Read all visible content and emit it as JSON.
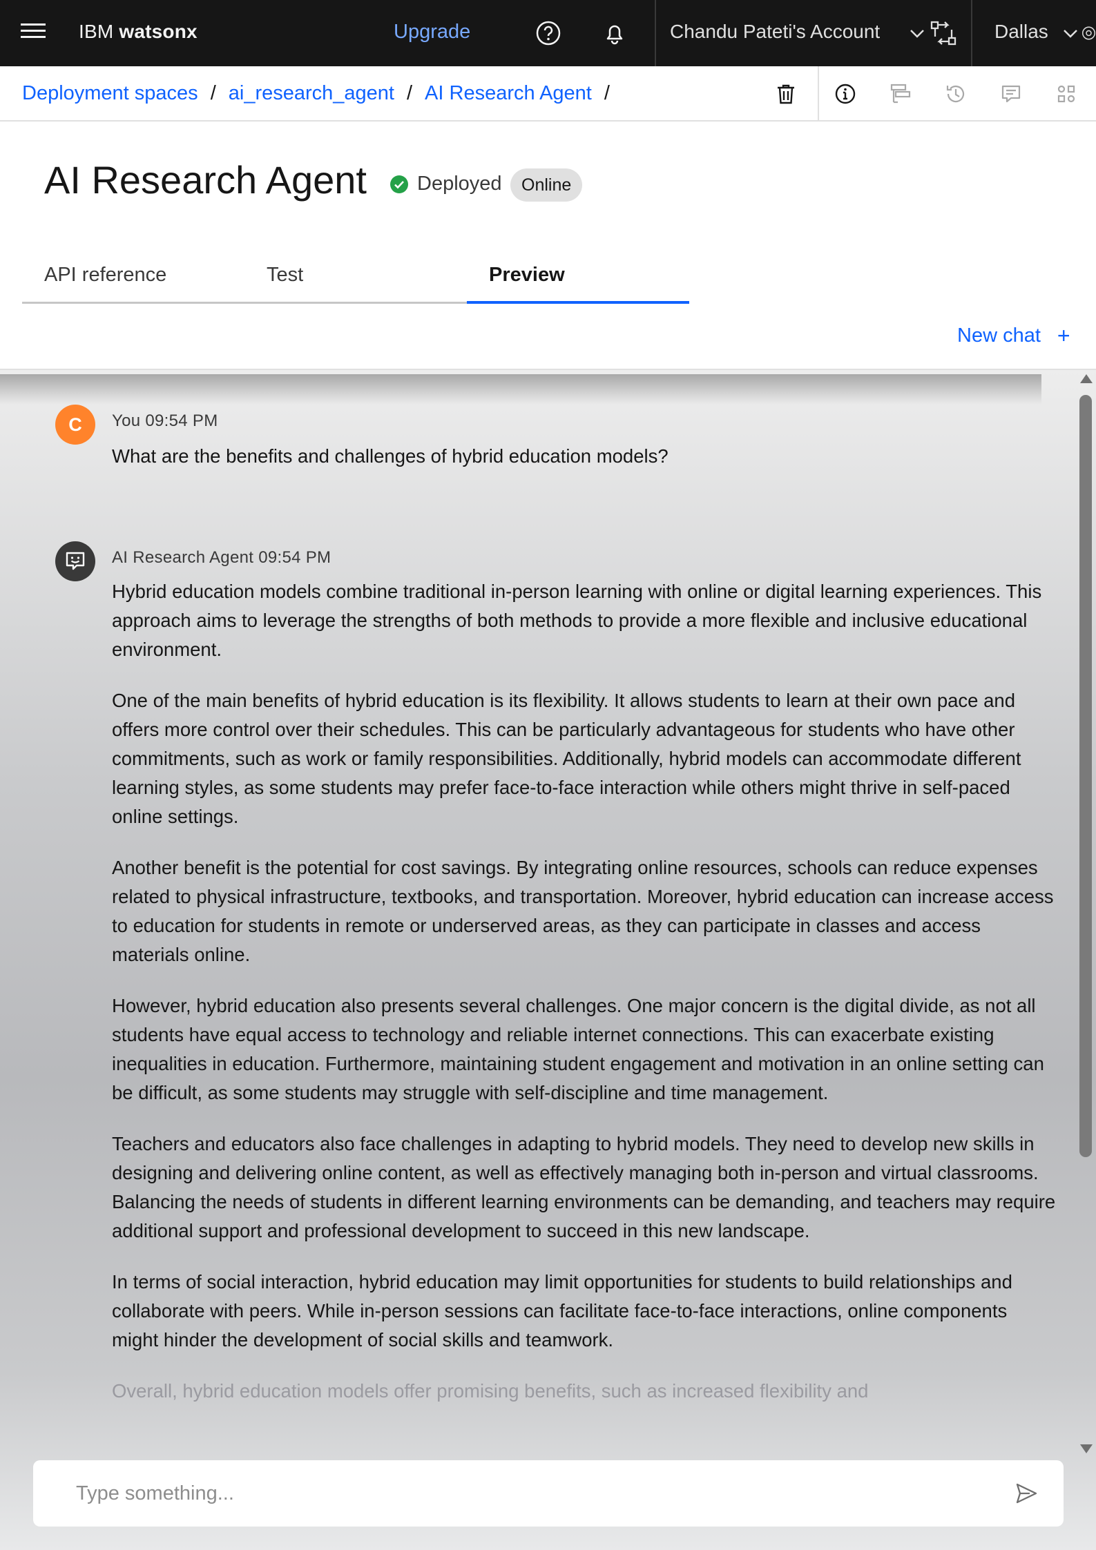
{
  "topbar": {
    "brand_prefix": "IBM ",
    "brand_name": "watsonx",
    "upgrade": "Upgrade",
    "account": "Chandu Pateti's Account",
    "region": "Dallas"
  },
  "breadcrumb": {
    "items": [
      "Deployment spaces",
      "ai_research_agent",
      "AI Research Agent"
    ],
    "separator": "/"
  },
  "page": {
    "title": "AI Research Agent",
    "status": "Deployed",
    "tag": "Online"
  },
  "tabs": [
    {
      "label": "API reference",
      "active": false
    },
    {
      "label": "Test",
      "active": false
    },
    {
      "label": "Preview",
      "active": true
    }
  ],
  "new_chat": "New chat",
  "chat": {
    "user": {
      "avatar_initial": "C",
      "meta": "You 09:54 PM",
      "text": "What are the benefits and challenges of hybrid education models?"
    },
    "agent": {
      "meta": "AI Research Agent 09:54 PM",
      "paragraphs": [
        "Hybrid education models combine traditional in-person learning with online or digital learning experiences. This approach aims to leverage the strengths of both methods to provide a more flexible and inclusive educational environment.",
        "One of the main benefits of hybrid education is its flexibility. It allows students to learn at their own pace and offers more control over their schedules. This can be particularly advantageous for students who have other commitments, such as work or family responsibilities. Additionally, hybrid models can accommodate different learning styles, as some students may prefer face-to-face interaction while others might thrive in self-paced online settings.",
        "Another benefit is the potential for cost savings. By integrating online resources, schools can reduce expenses related to physical infrastructure, textbooks, and transportation. Moreover, hybrid education can increase access to education for students in remote or underserved areas, as they can participate in classes and access materials online.",
        "However, hybrid education also presents several challenges. One major concern is the digital divide, as not all students have equal access to technology and reliable internet connections. This can exacerbate existing inequalities in education. Furthermore, maintaining student engagement and motivation in an online setting can be difficult, as some students may struggle with self-discipline and time management.",
        "Teachers and educators also face challenges in adapting to hybrid models. They need to develop new skills in designing and delivering online content, as well as effectively managing both in-person and virtual classrooms. Balancing the needs of students in different learning environments can be demanding, and teachers may require additional support and professional development to succeed in this new landscape.",
        "In terms of social interaction, hybrid education may limit opportunities for students to build relationships and collaborate with peers. While in-person sessions can facilitate face-to-face interactions, online components might hinder the development of social skills and teamwork.",
        "Overall, hybrid education models offer promising benefits, such as increased flexibility and"
      ]
    }
  },
  "composer": {
    "placeholder": "Type something..."
  },
  "colors": {
    "accent": "#0f62fe",
    "topbar_bg": "#161616",
    "user_avatar": "#ff832b",
    "deployed_green": "#24a148"
  },
  "icons": [
    "menu-icon",
    "help-icon",
    "notification-icon",
    "switcher-icon",
    "chevron-down-icon",
    "trash-icon",
    "info-icon",
    "tree-icon",
    "history-icon",
    "comment-icon",
    "apps-icon",
    "checkmark-filled-icon",
    "bot-icon",
    "send-icon",
    "plus-icon"
  ]
}
